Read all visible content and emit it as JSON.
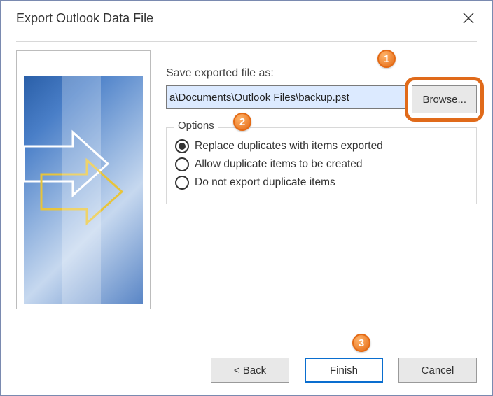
{
  "dialog": {
    "title": "Export Outlook Data File"
  },
  "main": {
    "save_label": "Save exported file as:",
    "path_value": "a\\Documents\\Outlook Files\\backup.pst",
    "browse_label": "Browse..."
  },
  "options": {
    "legend": "Options",
    "items": [
      {
        "label": "Replace duplicates with items exported",
        "selected": true
      },
      {
        "label": "Allow duplicate items to be created",
        "selected": false
      },
      {
        "label": "Do not export duplicate items",
        "selected": false
      }
    ]
  },
  "footer": {
    "back_label": "<  Back",
    "finish_label": "Finish",
    "cancel_label": "Cancel"
  },
  "callouts": {
    "c1": "1",
    "c2": "2",
    "c3": "3"
  },
  "colors": {
    "highlight_orange": "#e06a1a",
    "primary_blue": "#0a6ecf"
  }
}
